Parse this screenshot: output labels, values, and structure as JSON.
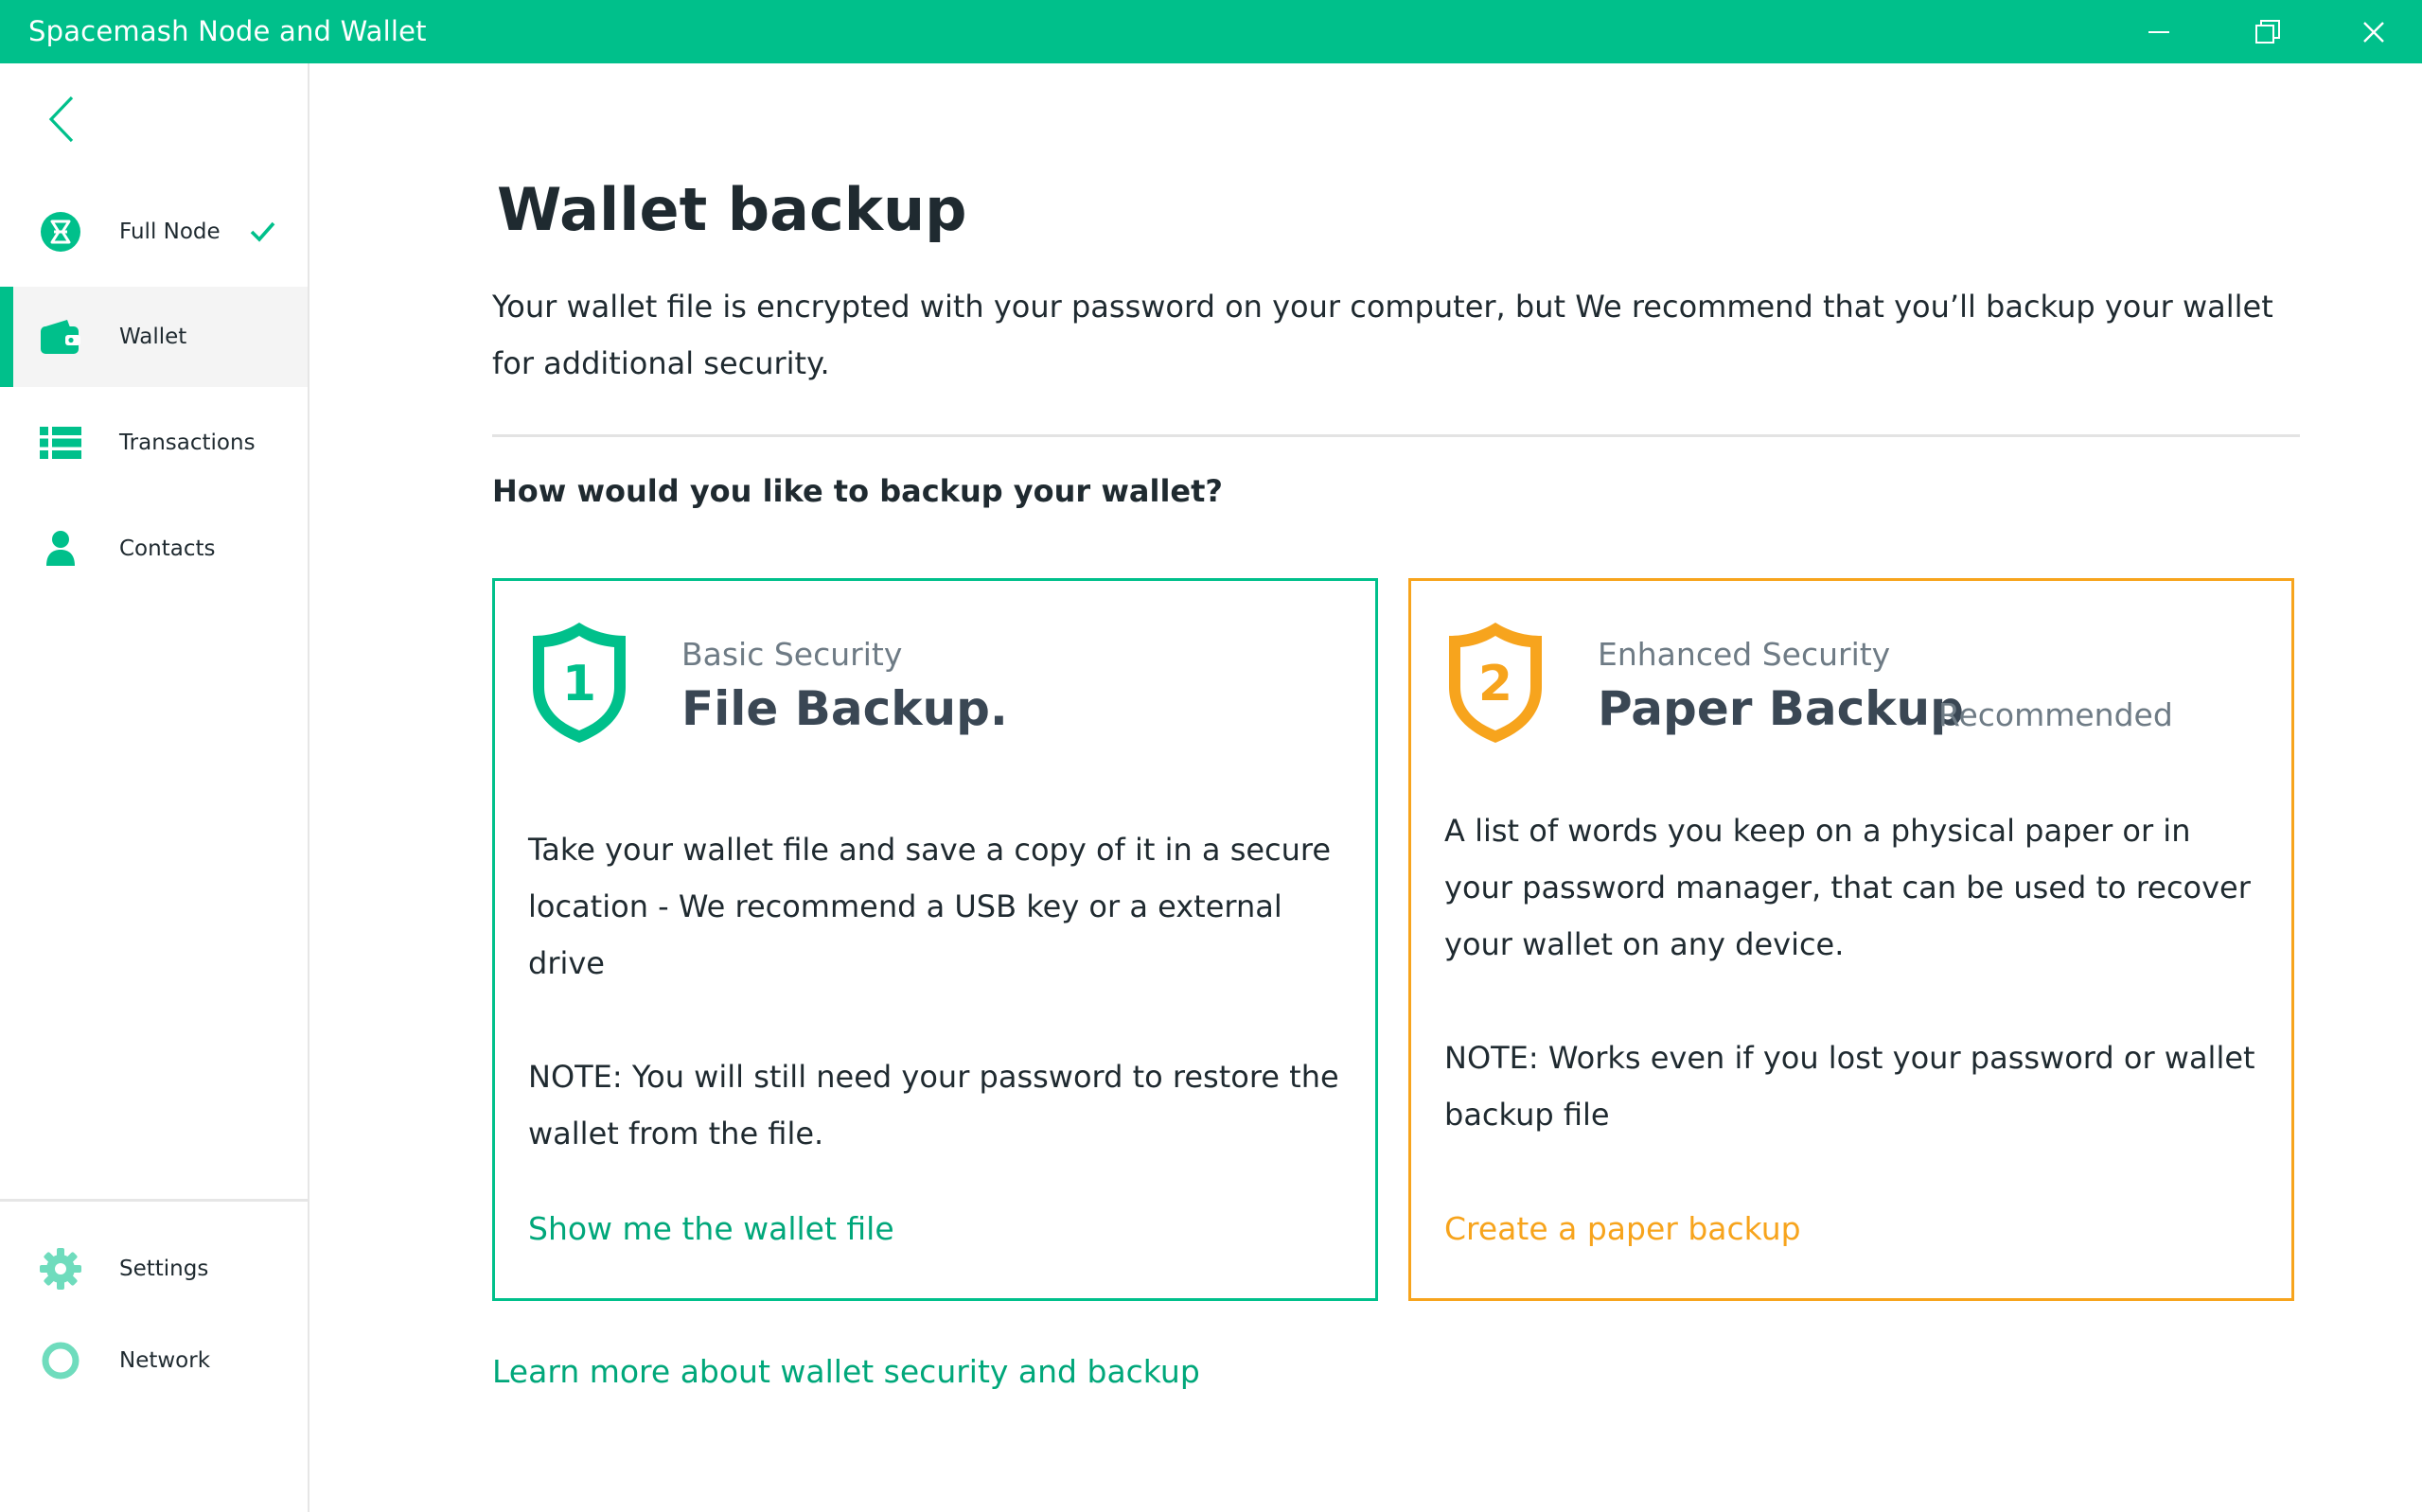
{
  "window": {
    "title": "Spacemash Node and Wallet",
    "controls": {
      "minimize_icon": "minimize-icon",
      "maximize_icon": "restore-icon",
      "close_icon": "close-icon"
    }
  },
  "colors": {
    "accent": "#00c08b",
    "accent_text": "#00a77a",
    "warning": "#f7a41d",
    "text": "#1f2a30",
    "muted": "#6e7b85"
  },
  "sidebar": {
    "back_icon": "chevron-left-icon",
    "items": [
      {
        "label": "Full Node",
        "icon": "spacemesh-node-icon",
        "status_icon": "check-icon",
        "active": false
      },
      {
        "label": "Wallet",
        "icon": "wallet-icon",
        "active": true
      },
      {
        "label": "Transactions",
        "icon": "list-icon",
        "active": false
      },
      {
        "label": "Contacts",
        "icon": "person-icon",
        "active": false
      }
    ],
    "bottom_items": [
      {
        "label": "Settings",
        "icon": "gear-icon"
      },
      {
        "label": "Network",
        "icon": "circle-icon"
      }
    ]
  },
  "main": {
    "title": "Wallet backup",
    "intro": "Your wallet file is encrypted with your password on your computer,  but We recommend that you’ll backup your wallet for additional security.",
    "question": "How would you like to backup your wallet?",
    "cards": [
      {
        "shield_number": "1",
        "kicker": "Basic Security",
        "heading": "File Backup.",
        "description": "Take your wallet file and save a copy of it in a secure location -  We recommend a USB key or a external drive",
        "note": "NOTE: You will still need your password to restore the wallet from the file.",
        "action": "Show me the wallet file"
      },
      {
        "shield_number": "2",
        "kicker": "Enhanced Security",
        "heading": "Paper Backup",
        "badge": "Recommended",
        "description": "A list of words you keep on a physical paper or in your password manager, that can be used to recover your wallet on any device.",
        "note": "NOTE: Works even if you lost  your password or wallet backup file",
        "action": "Create a paper backup"
      }
    ],
    "learn_more": "Learn more about wallet security and backup"
  }
}
